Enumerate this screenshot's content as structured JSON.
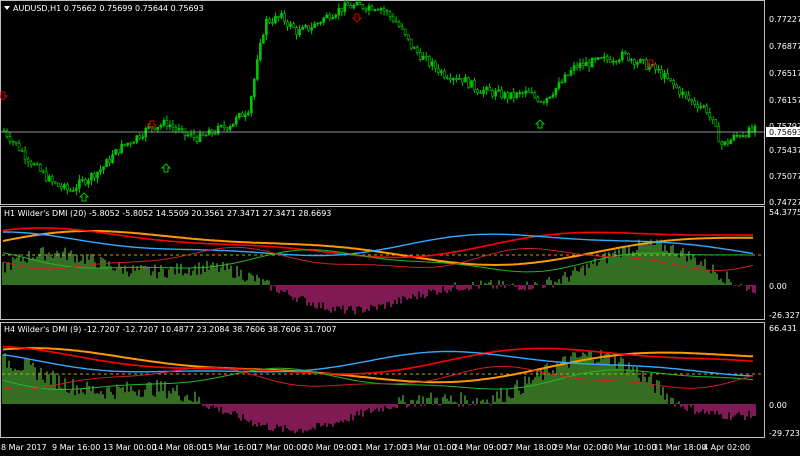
{
  "window": {
    "menu_icon": "triangle-down-icon",
    "main_title": "AUDUSD,H1  0.75662 0.75699 0.75644 0.75693",
    "dmi1_title": "H1 Wilder's DMI (20) -5.8052 -5.8052 14.5509 20.3561 27.3471 27.3471 28.6693",
    "dmi2_title": "H4 Wilder's DMI (9) -12.7207 -12.7207 10.4877 23.2084 38.7606 38.7606 31.7007"
  },
  "colors": {
    "background": "#000000",
    "grid_line": "#c0c0c0",
    "candle": "#00c800",
    "current_price_line": "#c0c0c0",
    "arrow_up": "#00c800",
    "arrow_down": "#d00000",
    "hist_pos": "#66dd44",
    "hist_neg": "#ff33aa",
    "adx_red": "#ff0000",
    "adx_blue": "#33aaff",
    "adx_orange": "#ff9900",
    "di_green": "#22bb22",
    "di_red": "#cc2222",
    "level_line": "#c8a000"
  },
  "main_axis": {
    "ticks": [
      "0.77227",
      "0.76877",
      "0.76517",
      "0.76157",
      "0.75797",
      "0.75437",
      "0.75077",
      "0.74727"
    ],
    "current_price": "0.75693"
  },
  "dmi1_axis": {
    "ticks": [
      "54.3775",
      "0.00",
      "-26.3277"
    ]
  },
  "dmi2_axis": {
    "ticks": [
      "66.431",
      "0.00",
      "-29.7233"
    ]
  },
  "time_axis": {
    "labels": [
      "8 Mar 2017",
      "9 Mar 16:00",
      "13 Mar 00:00",
      "14 Mar 08:00",
      "15 Mar 16:00",
      "17 Mar 00:00",
      "20 Mar 09:00",
      "21 Mar 17:00",
      "23 Mar 01:00",
      "24 Mar 09:00",
      "27 Mar 18:00",
      "29 Mar 02:00",
      "30 Mar 10:00",
      "31 Mar 18:00",
      "4 Apr 02:00"
    ]
  },
  "chart_data": {
    "type": "line",
    "title": "AUDUSD,H1",
    "ohlc_last": {
      "open": 0.75662,
      "high": 0.75699,
      "low": 0.75644,
      "close": 0.75693
    },
    "ylim": [
      0.74727,
      0.77407
    ],
    "approx_close_path": [
      0.757,
      0.7545,
      0.752,
      0.75,
      0.749,
      0.7505,
      0.752,
      0.7545,
      0.756,
      0.7575,
      0.758,
      0.7565,
      0.756,
      0.757,
      0.758,
      0.76,
      0.7715,
      0.772,
      0.77,
      0.771,
      0.7725,
      0.7735,
      0.7735,
      0.7735,
      0.7715,
      0.768,
      0.766,
      0.7645,
      0.764,
      0.7625,
      0.762,
      0.7615,
      0.762,
      0.761,
      0.763,
      0.7655,
      0.766,
      0.7665,
      0.767,
      0.766,
      0.765,
      0.763,
      0.761,
      0.76,
      0.755,
      0.7565,
      0.757
    ]
  }
}
